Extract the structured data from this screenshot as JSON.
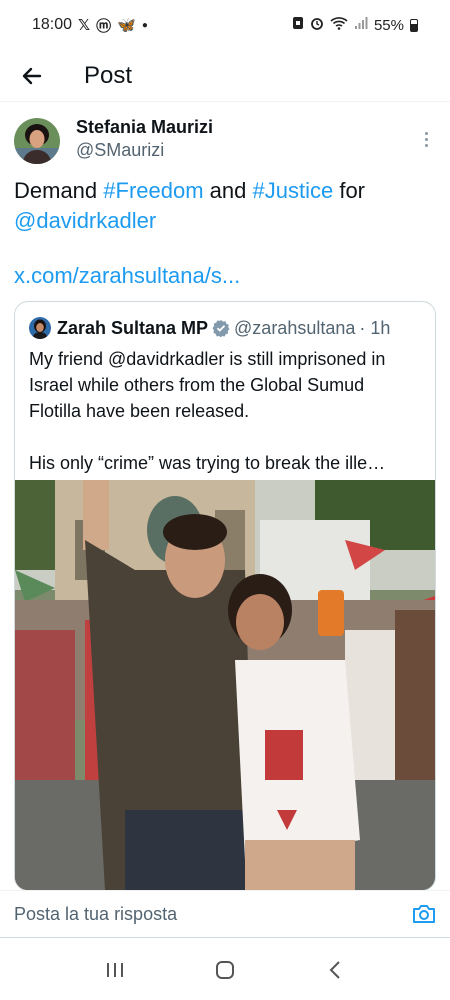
{
  "status_bar": {
    "time": "18:00",
    "app_icons": [
      "𝕏",
      "ⓜ",
      "🦋"
    ],
    "battery": "55%"
  },
  "header": {
    "title": "Post"
  },
  "post": {
    "author": {
      "name": "Stefania Maurizi",
      "handle": "@SMaurizi"
    },
    "text": {
      "prefix": "Demand ",
      "hashtag_1": "#Freedom",
      "middle": " and ",
      "hashtag_2": "#Justice",
      "suffix": " for",
      "mention": "@davidrkadler"
    },
    "link": "x.com/zarahsultana/s..."
  },
  "quote": {
    "name": "Zarah Sultana MP",
    "handle": "@zarahsultana",
    "time": "· 1h",
    "paragraph_1": "My friend @davidrkadler is still imprisoned in Israel while others from the Global Sumud Flotilla have been released.",
    "paragraph_2": "His only “crime” was trying to break the ille…"
  },
  "reply": {
    "placeholder": "Posta la tua risposta"
  },
  "colors": {
    "accent": "#1d9bf0",
    "text": "#0f1419",
    "secondary": "#536471"
  }
}
